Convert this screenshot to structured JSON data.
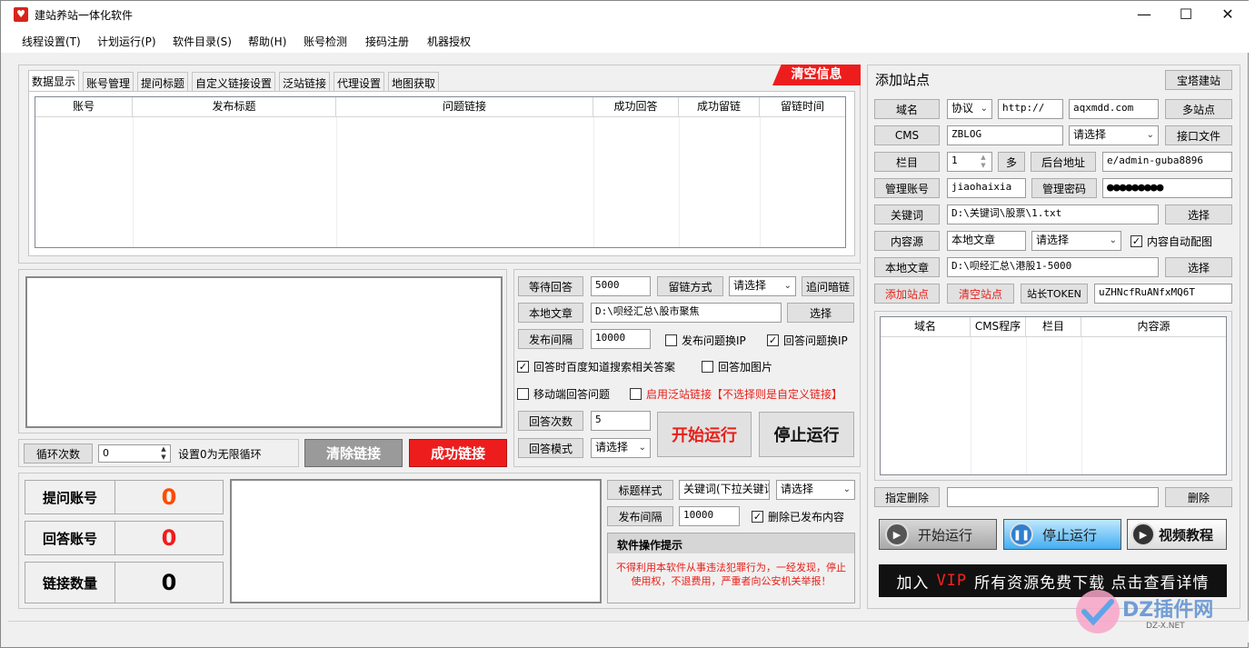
{
  "app": {
    "title": "建站养站一体化软件",
    "window_controls": {
      "minimize": "—",
      "maximize": "☐",
      "close": "✕"
    }
  },
  "menu": [
    "线程设置(T)",
    "计划运行(P)",
    "软件目录(S)",
    "帮助(H)",
    "账号检测",
    "接码注册",
    "机器授权"
  ],
  "tabs": [
    "数据显示",
    "账号管理",
    "提问标题",
    "自定义链接设置",
    "泛站链接",
    "代理设置",
    "地图获取"
  ],
  "clear_info_label": "清空信息",
  "data_table": {
    "columns": [
      "账号",
      "发布标题",
      "问题链接",
      "成功回答",
      "成功留链",
      "留链时间"
    ]
  },
  "loop": {
    "button": "循环次数",
    "value": "0",
    "hint": "设置0为无限循环",
    "clear_links": "清除链接",
    "success_links": "成功链接"
  },
  "answer_panel": {
    "wait_answer_btn": "等待回答",
    "wait_answer_value": "5000",
    "link_method_btn": "留链方式",
    "link_method_select": "请选择",
    "follow_dark_link_btn": "追问暗链",
    "local_article_btn": "本地文章",
    "local_article_path": "D:\\呗经汇总\\股市聚焦",
    "choose_btn": "选择",
    "publish_interval_btn": "发布间隔",
    "publish_interval_value": "10000",
    "chk_publish_ip": "发布问题换IP",
    "chk_answer_ip": "回答问题换IP",
    "chk_baidu_search": "回答时百度知道搜索相关答案",
    "chk_answer_image": "回答加图片",
    "chk_mobile": "移动端回答问题",
    "chk_pan_site": "启用泛站链接【不选择则是自定义链接】",
    "answer_count_btn": "回答次数",
    "answer_count_value": "5",
    "answer_mode_btn": "回答模式",
    "answer_mode_select": "请选择",
    "start_btn": "开始运行",
    "stop_btn": "停止运行",
    "checked": {
      "chk_publish_ip": false,
      "chk_answer_ip": true,
      "chk_baidu_search": true,
      "chk_answer_image": false,
      "chk_mobile": false,
      "chk_pan_site": false
    }
  },
  "stats": [
    {
      "label": "提问账号",
      "value": "0",
      "color": "#ff4a00"
    },
    {
      "label": "回答账号",
      "value": "0",
      "color": "#ee1d1d"
    },
    {
      "label": "链接数量",
      "value": "0",
      "color": "#000000"
    }
  ],
  "title_panel": {
    "title_style_btn": "标题样式",
    "title_style_value": "关键词(下拉关键词)",
    "title_style_select": "请选择",
    "publish_interval_btn": "发布间隔",
    "publish_interval_value": "10000",
    "chk_delete_published": "删除已发布内容",
    "notice_title": "软件操作提示",
    "notice_body": "不得利用本软件从事违法犯罪行为，一经发现，停止使用权，不退费用，严重者向公安机关举报！"
  },
  "site_panel": {
    "heading": "添加站点",
    "pagoda_btn": "宝塔建站",
    "domain_btn": "域名",
    "protocol_select": "协议",
    "protocol_value": "http://",
    "domain_value": "aqxmdd.com",
    "multi_site_btn": "多站点",
    "cms_btn": "CMS",
    "cms_value": "ZBLOG",
    "cms_select": "请选择",
    "interface_btn": "接口文件",
    "column_btn": "栏目",
    "column_value": "1",
    "multi_btn": "多",
    "admin_url_btn": "后台地址",
    "admin_url_value": "e/admin-guba8896",
    "admin_user_btn": "管理账号",
    "admin_user_value": "jiaohaixia",
    "admin_pass_btn": "管理密码",
    "admin_pass_value": "●●●●●●●●●",
    "keyword_btn": "关键词",
    "keyword_path": "D:\\关键词\\股票\\1.txt",
    "choose_btn": "选择",
    "content_source_btn": "内容源",
    "content_source_value": "本地文章",
    "content_source_select": "请选择",
    "chk_auto_image": "内容自动配图",
    "local_article_btn": "本地文章",
    "local_article_path": "D:\\呗经汇总\\港股1-5000",
    "add_site_btn": "添加站点",
    "clear_site_btn": "清空站点",
    "token_btn": "站长TOKEN",
    "token_value": "uZHNcfRuANfxMQ6T",
    "site_table_columns": [
      "域名",
      "CMS程序",
      "栏目",
      "内容源"
    ],
    "delete_specified_btn": "指定删除",
    "delete_btn": "删除",
    "start_btn": "开始运行",
    "stop_btn": "停止运行",
    "video_btn": "视频教程",
    "vip_prefix": "加入",
    "vip_word": "VIP",
    "vip_suffix": "所有资源免费下载 点击查看详情"
  },
  "watermark": {
    "text": "DZ插件网",
    "sub": "DZ-X.NET"
  }
}
